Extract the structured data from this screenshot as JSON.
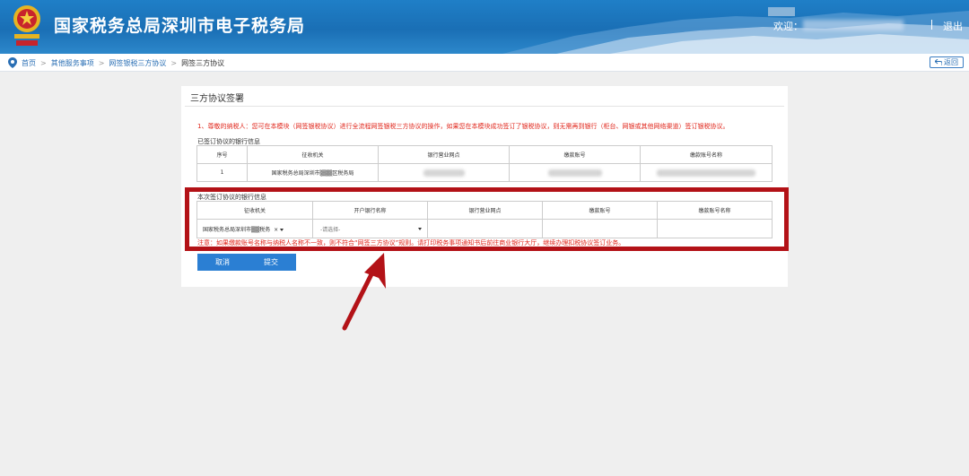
{
  "header": {
    "title": "国家税务总局深圳市电子税务局",
    "welcome": "欢迎：",
    "logout": "退出"
  },
  "breadcrumb": {
    "home": "首页",
    "level1": "其他服务事项",
    "level2": "网签银税三方协议",
    "current": "网签三方协议",
    "back": "返回"
  },
  "panel": {
    "title": "三方协议签署",
    "notice": "1、尊敬的纳税人：您可在本模块（网签银税协议）进行全流程网签银税三方协议的操作，如果您在本模块成功签订了银税协议，则无需再到银行（柜台、网银或其他网络渠道）签订银税协议。"
  },
  "signed": {
    "section_label": "已签订协议的银行信息",
    "columns": [
      "序号",
      "征收机关",
      "银行营业网点",
      "缴款账号",
      "缴款账号名称"
    ],
    "rows": [
      {
        "index": "1",
        "authority": "国家税务总局深圳市▒▒▒区税务局"
      }
    ]
  },
  "current": {
    "section_label": "本次签订协议的银行信息",
    "columns": [
      "征收机关",
      "开户银行名称",
      "银行营业网点",
      "缴款账号",
      "缴款账号名称"
    ],
    "authority_value": "国家税务总局深圳市▒▒税务",
    "bank_placeholder": "-请选择-"
  },
  "warning": "注意：如果缴款账号名称与纳税人名称不一致，则不符合“网签三方协议”规则。请打印税务事项通知书后前往商业银行大厅，继续办理扣税协议签订业务。",
  "buttons": {
    "cancel": "取消",
    "submit": "提交"
  },
  "colors": {
    "header_blue": "#1a6fb5",
    "button_blue": "#2b7fd3",
    "alert_red": "#e0261b",
    "annotation_red": "#b31217"
  },
  "icons": {
    "emblem": "tax-emblem-icon",
    "location": "location-pin-icon",
    "back": "back-arrow-icon",
    "dropdown": "chevron-down-icon",
    "clear": "clear-x-icon"
  }
}
